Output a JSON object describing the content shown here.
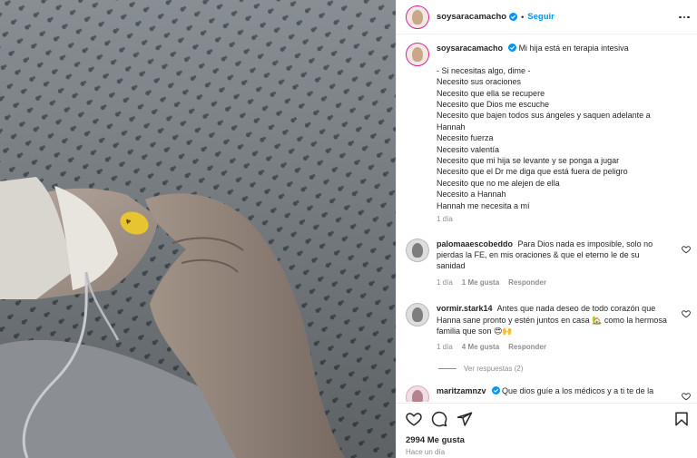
{
  "post": {
    "author": "soysaracamacho",
    "follow_label": "Seguir",
    "separator": "•",
    "caption_lines": [
      "Mi hija está en terapia intesiva",
      "",
      "- Si necesitas algo, dime -",
      "Necesito sus oraciones",
      "Necesito que ella se recupere",
      "Necesito que Dios me escuche",
      "Necesito que bajen todos sus ángeles y saquen adelante a",
      "Hannah",
      "Necesito fuerza",
      "Necesito valentía",
      "Necesito que mi hija se levante y se ponga a jugar",
      "Necesito que el Dr me diga que está fuera de peligro",
      "Necesito que no me alejen de ella",
      "Necesito a Hannah",
      "Hannah me necesita a mí"
    ],
    "caption_age": "1 día",
    "likes": "2994 Me gusta",
    "posted_ago": "Hace un día"
  },
  "comments": [
    {
      "user": "palomaaescobeddo",
      "lines": [
        "Para Dios nada es imposible, solo no",
        "pierdas la FE, en mis oraciones & que el eterno le de su",
        "sanidad"
      ],
      "age": "1 día",
      "likes": "1 Me gusta",
      "reply": "Responder"
    },
    {
      "user": "vormir.stark14",
      "lines": [
        "Antes que nada deseo de todo corazón que",
        "Hanna sane pronto y estén juntos en casa 🏡 como la hermosa",
        "familia que son 😍🙌"
      ],
      "age": "1 día",
      "likes": "4 Me gusta",
      "reply": "Responder",
      "view_replies": "Ver respuestas (2)"
    },
    {
      "user": "maritzamnzv",
      "lines": [
        "Que dios guíe a los médicos y a ti te de la"
      ]
    }
  ],
  "colors": {
    "accent": "#0095f6",
    "verified": "#0095f6",
    "muted": "#8e8e8e",
    "text": "#262626"
  },
  "icons": [
    "heart-icon",
    "comment-icon",
    "share-icon",
    "bookmark-icon",
    "more-options-icon",
    "verified-badge-icon"
  ]
}
